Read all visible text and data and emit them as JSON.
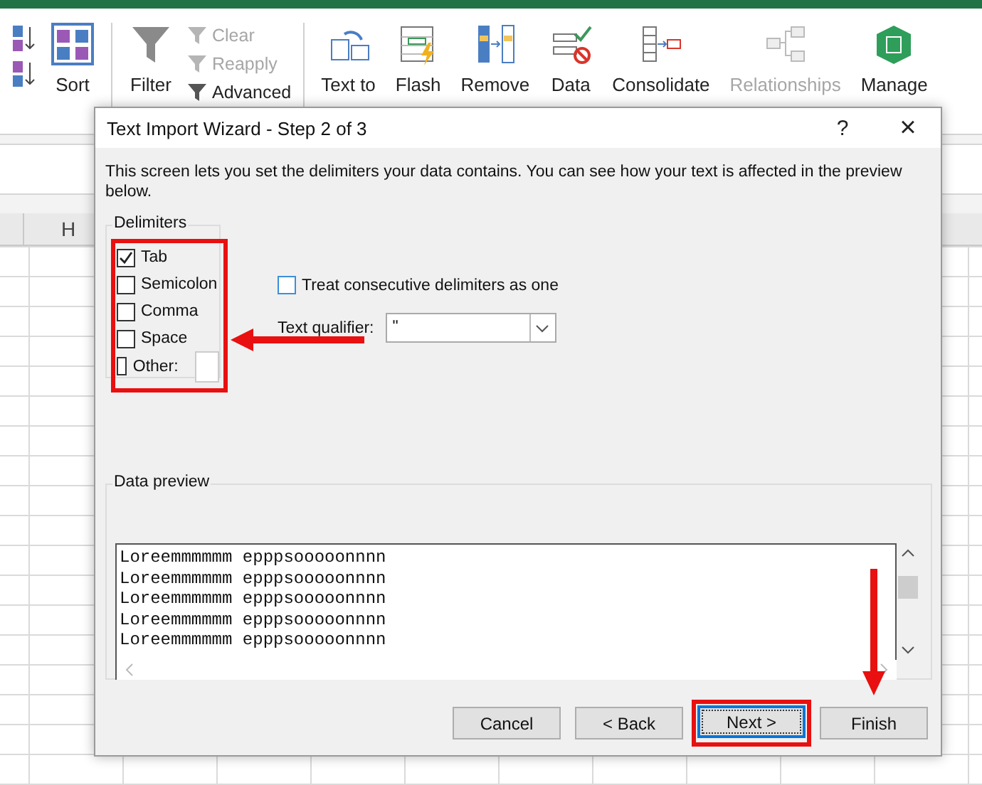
{
  "ribbon": {
    "sort": {
      "label": "Sort"
    },
    "filter": {
      "label": "Filter"
    },
    "filter_options": [
      {
        "label": "Clear",
        "disabled": true
      },
      {
        "label": "Reapply",
        "disabled": true
      },
      {
        "label": "Advanced",
        "disabled": false
      }
    ],
    "data_tools": [
      {
        "label": "Text to",
        "disabled": false
      },
      {
        "label": "Flash",
        "disabled": false
      },
      {
        "label": "Remove",
        "disabled": false
      },
      {
        "label": "Data",
        "disabled": false
      },
      {
        "label": "Consolidate",
        "disabled": false
      },
      {
        "label": "Relationships",
        "disabled": true
      },
      {
        "label": "Manage",
        "disabled": false
      }
    ]
  },
  "sheet": {
    "column_header": "H"
  },
  "dialog": {
    "title": "Text Import Wizard - Step 2 of 3",
    "help": "?",
    "close": "×",
    "description": "This screen lets you set the delimiters your data contains.  You can see how your text is affected in the preview below.",
    "delimiters": {
      "title": "Delimiters",
      "highlighted": true,
      "items": [
        {
          "label": "Tab",
          "checked": true,
          "kind": "checkbox"
        },
        {
          "label": "Semicolon",
          "checked": false,
          "kind": "checkbox"
        },
        {
          "label": "Comma",
          "checked": false,
          "kind": "checkbox"
        },
        {
          "label": "Space",
          "checked": false,
          "kind": "checkbox"
        },
        {
          "label": "Other:",
          "checked": false,
          "kind": "checkbox_field"
        }
      ]
    },
    "consecutive": {
      "label": "Treat consecutive delimiters as one",
      "checked": false
    },
    "qualifier": {
      "label": "Text qualifier:",
      "value": "\""
    },
    "preview": {
      "title": "Data preview",
      "lines": [
        "Loreemmmmmm epppsooooonnnn",
        "Loreemmmmmm epppsooooonnnn",
        "Loreemmmmmm epppsooooonnnn",
        "Loreemmmmmm epppsooooonnnn",
        "Loreemmmmmm epppsooooonnnn"
      ]
    },
    "buttons": [
      {
        "label": "Cancel",
        "focused": false,
        "highlighted": false
      },
      {
        "label": "< Back",
        "focused": false,
        "highlighted": false
      },
      {
        "label": "Next >",
        "focused": true,
        "highlighted": true
      },
      {
        "label": "Finish",
        "focused": false,
        "highlighted": false
      }
    ]
  }
}
